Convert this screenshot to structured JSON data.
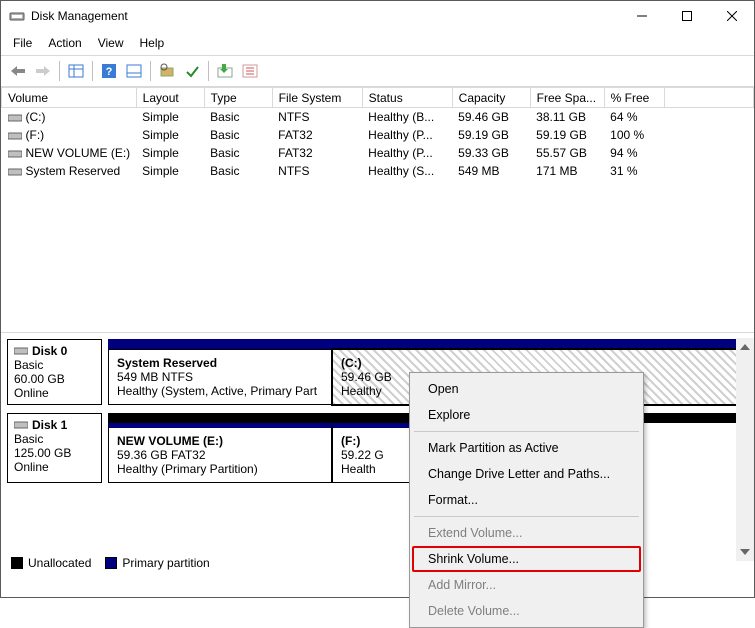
{
  "window": {
    "title": "Disk Management"
  },
  "menu": {
    "file": "File",
    "action": "Action",
    "view": "View",
    "help": "Help"
  },
  "columns": {
    "volume": "Volume",
    "layout": "Layout",
    "type": "Type",
    "fs": "File System",
    "status": "Status",
    "capacity": "Capacity",
    "free": "Free Spa...",
    "pct": "% Free"
  },
  "volumes": [
    {
      "name": "(C:)",
      "layout": "Simple",
      "type": "Basic",
      "fs": "NTFS",
      "status": "Healthy (B...",
      "capacity": "59.46 GB",
      "free": "38.11 GB",
      "pct": "64 %"
    },
    {
      "name": "(F:)",
      "layout": "Simple",
      "type": "Basic",
      "fs": "FAT32",
      "status": "Healthy (P...",
      "capacity": "59.19 GB",
      "free": "59.19 GB",
      "pct": "100 %"
    },
    {
      "name": "NEW VOLUME (E:)",
      "layout": "Simple",
      "type": "Basic",
      "fs": "FAT32",
      "status": "Healthy (P...",
      "capacity": "59.33 GB",
      "free": "55.57 GB",
      "pct": "94 %"
    },
    {
      "name": "System Reserved",
      "layout": "Simple",
      "type": "Basic",
      "fs": "NTFS",
      "status": "Healthy (S...",
      "capacity": "549 MB",
      "free": "171 MB",
      "pct": "31 %"
    }
  ],
  "disks": {
    "d0": {
      "name": "Disk 0",
      "type": "Basic",
      "size": "60.00 GB",
      "state": "Online",
      "p1": {
        "name": "System Reserved",
        "info": "549 MB NTFS",
        "status": "Healthy (System, Active, Primary Part"
      },
      "p2": {
        "name": "(C:)",
        "info": "59.46 GB",
        "status": "Healthy"
      }
    },
    "d1": {
      "name": "Disk 1",
      "type": "Basic",
      "size": "125.00 GB",
      "state": "Online",
      "p1": {
        "name": "NEW VOLUME  (E:)",
        "info": "59.36 GB FAT32",
        "status": "Healthy (Primary Partition)"
      },
      "p2": {
        "name": "(F:)",
        "info": "59.22 G",
        "status": "Health"
      }
    }
  },
  "legend": {
    "unallocated": "Unallocated",
    "primary": "Primary partition"
  },
  "context": {
    "open": "Open",
    "explore": "Explore",
    "markActive": "Mark Partition as Active",
    "changeLetter": "Change Drive Letter and Paths...",
    "format": "Format...",
    "extend": "Extend Volume...",
    "shrink": "Shrink Volume...",
    "addMirror": "Add Mirror...",
    "deleteVol": "Delete Volume..."
  }
}
